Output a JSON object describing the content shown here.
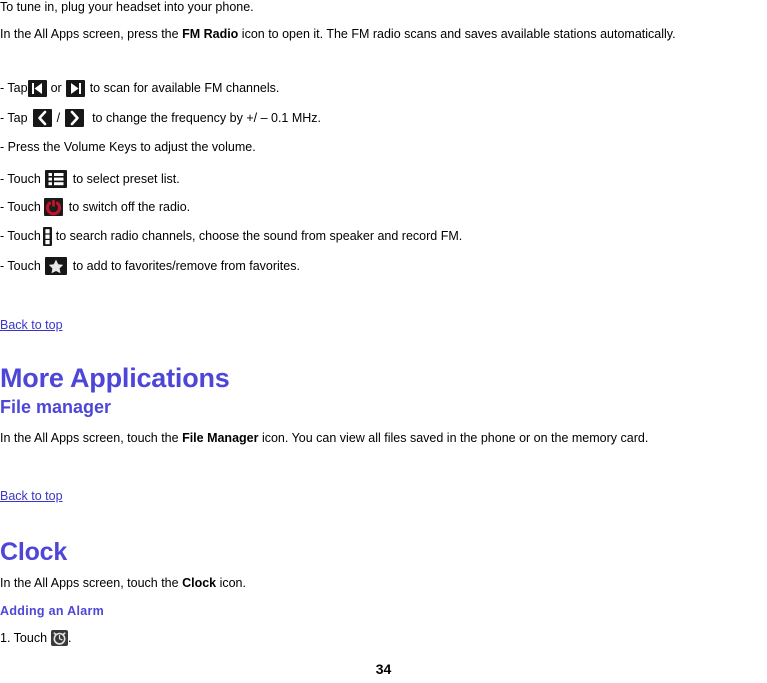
{
  "document": {
    "page_number": "34",
    "link_color": "#3a36c8",
    "heading_color": "#4e46d8"
  },
  "fm_radio_section": {
    "intro_line": "To tune in, plug your headset into your phone.",
    "paragraph_pre": "In the All Apps screen, press the ",
    "paragraph_bold": "FM Radio",
    "paragraph_post": " icon to open it. The FM radio scans and saves available stations automatically.",
    "bullets": [
      {
        "prefix": "- Tap ",
        "icon_1": "skip-previous-icon",
        "mid": " or ",
        "icon_2": "skip-next-icon",
        "suffix": " to scan for available FM channels."
      },
      {
        "prefix": "- Tap ",
        "icon_1": "chevron-left-icon",
        "mid": " / ",
        "icon_2": "chevron-right-icon",
        "suffix": " to change the frequency by +/ – 0.1 MHz."
      },
      {
        "prefix": "- Press the Volume Keys to adjust the volume.",
        "icon_1": null,
        "mid": "",
        "icon_2": null,
        "suffix": ""
      },
      {
        "prefix": "- Touch ",
        "icon_1": "preset-list-icon",
        "mid": "",
        "icon_2": null,
        "suffix": " to select preset list."
      },
      {
        "prefix": "- Touch ",
        "icon_1": "power-off-icon",
        "mid": "",
        "icon_2": null,
        "suffix": " to switch off the radio."
      },
      {
        "prefix": "- Touch ",
        "icon_1": "overflow-menu-icon",
        "mid": "",
        "icon_2": null,
        "suffix": " to search radio channels, choose the sound from speaker and record FM."
      },
      {
        "prefix": "- Touch ",
        "icon_1": "favorites-star-icon",
        "mid": "",
        "icon_2": null,
        "suffix": " to add to favorites/remove from favorites."
      }
    ],
    "back_to_top": "Back to top"
  },
  "more_applications": {
    "heading": "More Applications",
    "subheading": "File manager",
    "paragraph_pre": "In the All Apps screen, touch the ",
    "paragraph_bold": "File Manager",
    "paragraph_post": " icon. You can view all files saved in the phone or on the memory card.",
    "back_to_top": "Back to top"
  },
  "clock_section": {
    "heading": "Clock",
    "paragraph_pre": "In the All Apps screen, touch the ",
    "paragraph_bold": "Clock",
    "paragraph_post": " icon.",
    "subheading": "Adding an Alarm",
    "step_1_prefix": "1. Touch ",
    "step_1_icon": "alarm-clock-icon",
    "step_1_suffix": "."
  }
}
